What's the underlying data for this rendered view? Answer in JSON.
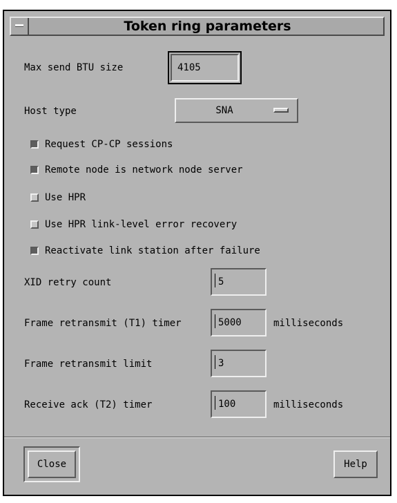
{
  "window": {
    "title": "Token ring parameters"
  },
  "form": {
    "max_send_btu": {
      "label": "Max send BTU size",
      "value": "4105"
    },
    "host_type": {
      "label": "Host type",
      "value": "SNA"
    },
    "checkboxes": [
      {
        "label": "Request CP-CP sessions",
        "checked": true
      },
      {
        "label": "Remote node is network node server",
        "checked": true
      },
      {
        "label": "Use HPR",
        "checked": false
      },
      {
        "label": "Use HPR link-level error recovery",
        "checked": false
      },
      {
        "label": "Reactivate link station after failure",
        "checked": true
      }
    ],
    "xid_retry": {
      "label": "XID retry count",
      "value": "5"
    },
    "t1_timer": {
      "label": "Frame retransmit (T1) timer",
      "value": "5000",
      "unit": "milliseconds"
    },
    "retransmit_limit": {
      "label": "Frame retransmit limit",
      "value": "3"
    },
    "t2_timer": {
      "label": "Receive ack (T2) timer",
      "value": "100",
      "unit": "milliseconds"
    }
  },
  "buttons": {
    "close_label": "Close",
    "help_label": "Help"
  }
}
